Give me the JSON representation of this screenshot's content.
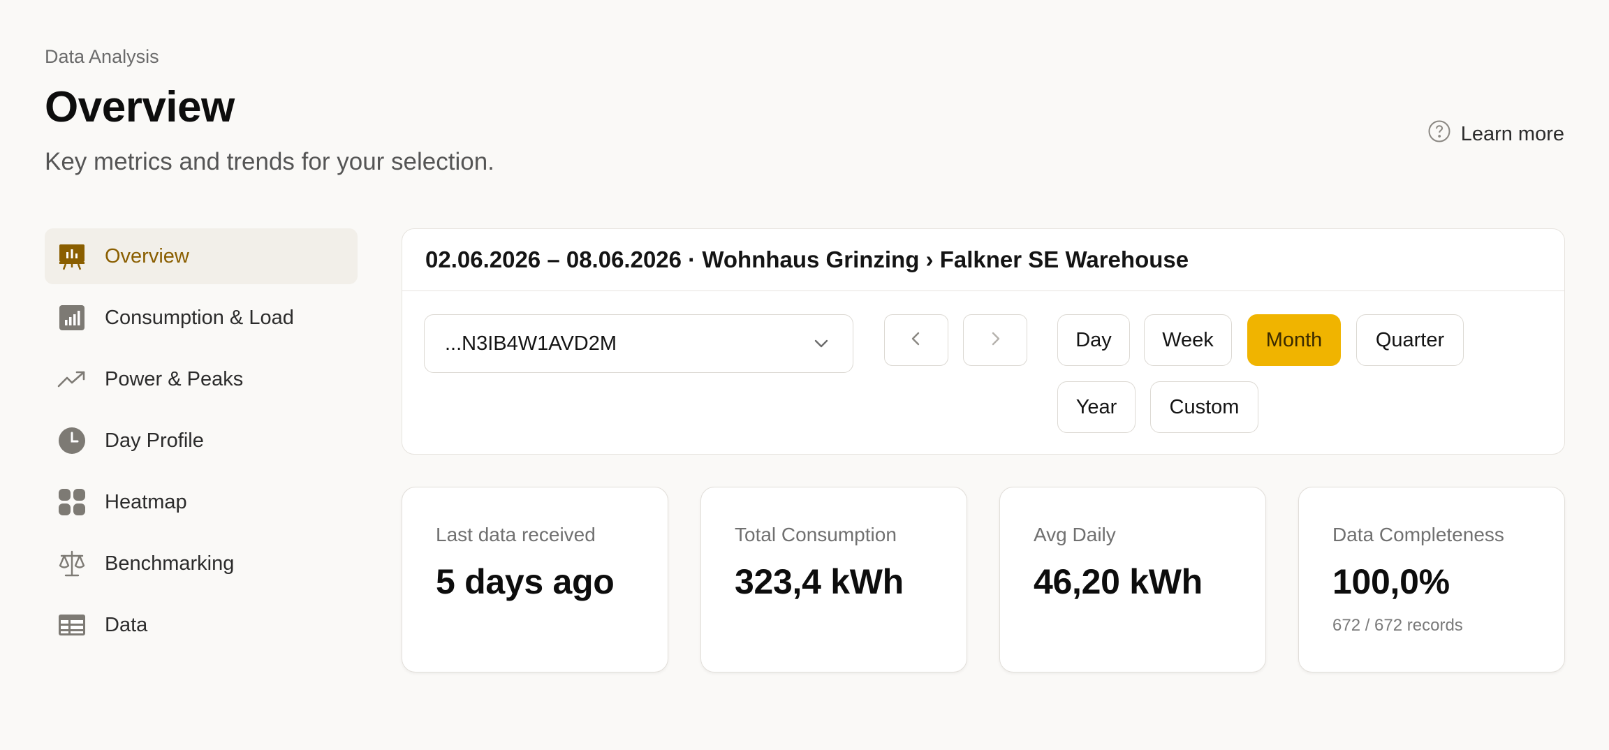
{
  "header": {
    "eyebrow": "Data Analysis",
    "title": "Overview",
    "subtitle": "Key metrics and trends for your selection.",
    "learn_more": "Learn more"
  },
  "sidebar": {
    "items": [
      {
        "label": "Overview",
        "icon": "presentation-chart-icon",
        "active": true
      },
      {
        "label": "Consumption & Load",
        "icon": "bar-chart-icon",
        "active": false
      },
      {
        "label": "Power & Peaks",
        "icon": "trending-up-icon",
        "active": false
      },
      {
        "label": "Day Profile",
        "icon": "clock-icon",
        "active": false
      },
      {
        "label": "Heatmap",
        "icon": "grid-icon",
        "active": false
      },
      {
        "label": "Benchmarking",
        "icon": "scale-icon",
        "active": false
      },
      {
        "label": "Data",
        "icon": "table-icon",
        "active": false
      }
    ]
  },
  "selection": {
    "heading": "02.06.2026 – 08.06.2026 · Wohnhaus Grinzing › Falkner SE Warehouse",
    "device_value": "...N3IB4W1AVD2M",
    "periods": [
      {
        "label": "Day",
        "active": false
      },
      {
        "label": "Week",
        "active": false
      },
      {
        "label": "Month",
        "active": true
      },
      {
        "label": "Quarter",
        "active": false
      },
      {
        "label": "Year",
        "active": false
      },
      {
        "label": "Custom",
        "active": false
      }
    ]
  },
  "kpis": [
    {
      "label": "Last data received",
      "value": "5 days ago",
      "note": ""
    },
    {
      "label": "Total Consumption",
      "value": "323,4 kWh",
      "note": ""
    },
    {
      "label": "Avg Daily",
      "value": "46,20 kWh",
      "note": ""
    },
    {
      "label": "Data Completeness",
      "value": "100,0%",
      "note": "672 / 672 records"
    }
  ],
  "colors": {
    "accent": "#f0b400",
    "active_text": "#8a5e00",
    "icon_gray": "#7d7a74",
    "background": "#faf9f7"
  }
}
